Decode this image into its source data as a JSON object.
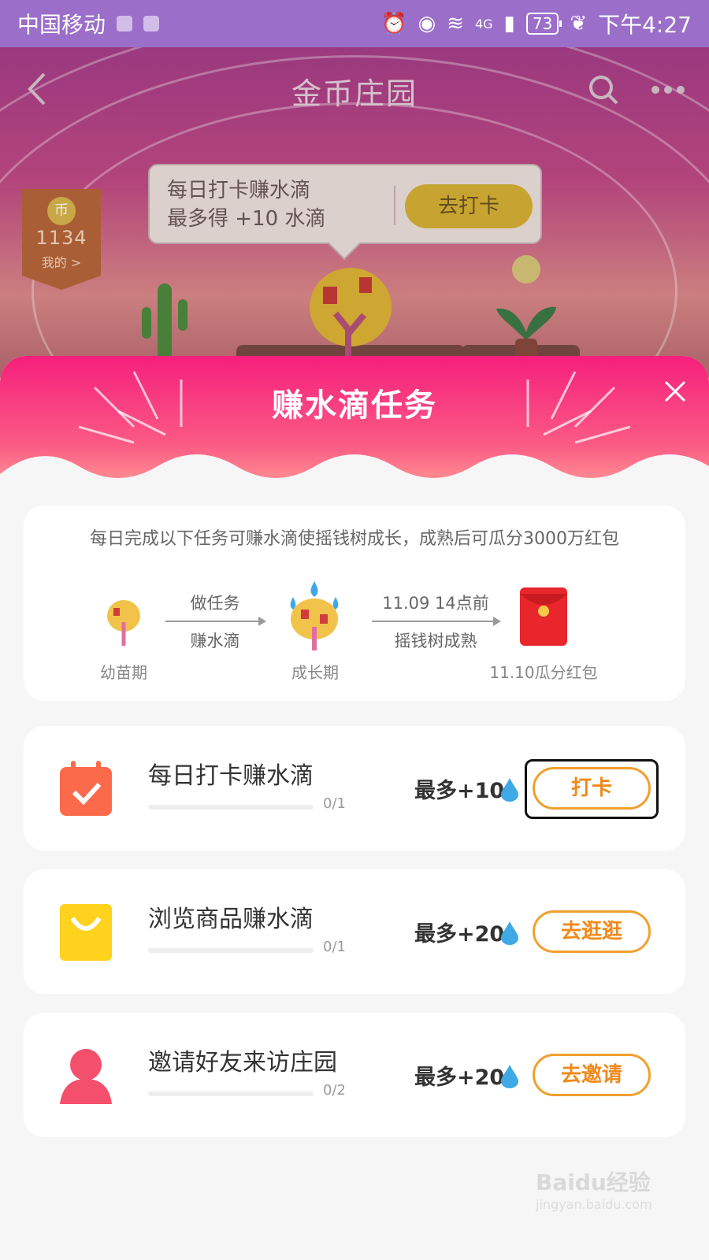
{
  "status_bar": {
    "carrier": "中国移动",
    "network": "4G",
    "battery": "73",
    "time": "下午4:27"
  },
  "nav": {
    "title": "金币庄园"
  },
  "coins": {
    "badge": "币",
    "count": "1134",
    "my_label": "我的 >"
  },
  "checkin_bubble": {
    "line1": "每日打卡赚水滴",
    "line2": "最多得 +10 水滴",
    "button": "去打卡"
  },
  "panel": {
    "title": "赚水滴任务",
    "description": "每日完成以下任务可赚水滴使摇钱树成长，成熟后可瓜分3000万红包",
    "stages": [
      {
        "label": "幼苗期"
      },
      {
        "label": "成长期"
      },
      {
        "label": "11.10瓜分红包"
      }
    ],
    "arrows": [
      {
        "top": "做任务",
        "bottom": "赚水滴"
      },
      {
        "top": "11.09 14点前",
        "bottom": "摇钱树成熟"
      }
    ]
  },
  "tasks": [
    {
      "name": "每日打卡赚水滴",
      "progress": "0/1",
      "reward": "最多+10",
      "button": "打卡",
      "icon": "calendar-check-icon",
      "color": "#fb6b4b"
    },
    {
      "name": "浏览商品赚水滴",
      "progress": "0/1",
      "reward": "最多+20",
      "button": "去逛逛",
      "icon": "shopping-bag-icon",
      "color": "#ffd21e"
    },
    {
      "name": "邀请好友来访庄园",
      "progress": "0/2",
      "reward": "最多+20",
      "button": "去邀请",
      "icon": "user-icon",
      "color": "#f4506d"
    }
  ],
  "watermark": {
    "text": "Baidu经验",
    "sub": "jingyan.baidu.com"
  },
  "colors": {
    "accent": "#f0891a",
    "header": "#f51f7c",
    "statusbar": "#9a6ec9"
  }
}
